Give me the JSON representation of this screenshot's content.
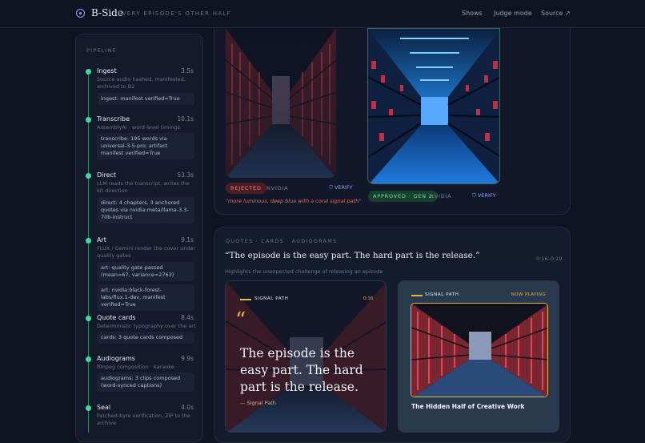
{
  "header": {
    "brand": "B-Side",
    "tagline": "EVERY EPISODE'S OTHER HALF",
    "nav": [
      "Shows",
      "Judge mode",
      "Source ↗"
    ]
  },
  "sidebar": {
    "title": "PIPELINE",
    "steps": [
      {
        "name": "Ingest",
        "time": "3.5s",
        "desc": "Source audio hashed, manifested, archived to B2",
        "logs": [
          "ingest: manifest verified=True"
        ]
      },
      {
        "name": "Transcribe",
        "time": "10.1s",
        "desc": "AssemblyAI · word-level timings",
        "logs": [
          "transcribe: 195 words via universal-3-5-pro; artifact manifest verified=True"
        ]
      },
      {
        "name": "Direct",
        "time": "53.3s",
        "desc": "LLM reads the transcript, writes the kit direction",
        "logs": [
          "direct: 4 chapters, 3 anchored quotes via nvidia:meta/llama-3.3-70b-instruct"
        ]
      },
      {
        "name": "Art",
        "time": "9.1s",
        "desc": "FLUX / Gemini render the cover under quality gates",
        "logs": [
          "art: quality gate passed (mean=67, variance=2763)",
          "art: nvidia:black-forest-labs/flux.1-dev, manifest verified=True"
        ]
      },
      {
        "name": "Quote cards",
        "time": "8.4s",
        "desc": "Deterministic typography over the art",
        "logs": [
          "cards: 3 quote cards composed"
        ]
      },
      {
        "name": "Audiograms",
        "time": "9.9s",
        "desc": "ffmpeg composition · karaoke captions",
        "logs": [
          "audiograms: 3 clips composed (word-synced captions)"
        ]
      },
      {
        "name": "Seal",
        "time": "4.0s",
        "desc": "Fetched-byte verification, ZIP to the archive",
        "logs": []
      }
    ]
  },
  "art": {
    "left": {
      "badge": "REJECTED",
      "provider": "NVIDIA",
      "verify": "VERIFY",
      "note": "\"more luminous, deep blue with a coral signal path\""
    },
    "right": {
      "badge": "APPROVED · GEN 2",
      "provider": "NVIDIA",
      "verify": "VERIFY"
    }
  },
  "quotes": {
    "section_label": "QUOTES · CARDS · AUDIOGRAMS",
    "quote": "“The episode is the easy part. The hard part is the release.”",
    "timecode": "0:16–0:19",
    "subtitle": "Highlights the unexpected challenge of releasing an episode",
    "card1": {
      "show": "SIGNAL PATH",
      "time": "0:16",
      "quote": "The episode is the easy part. The hard part is the release.",
      "attrib": "— Signal Path"
    },
    "card2": {
      "show": "SIGNAL PATH",
      "status": "NOW PLAYING",
      "title": "The Hidden Half of Creative Work"
    }
  },
  "colors": {
    "bg": "#0f1423",
    "accent": "#8fa3ff",
    "green": "#3ddc97",
    "coral": "#e05a4f",
    "gold": "#e0b84a"
  }
}
